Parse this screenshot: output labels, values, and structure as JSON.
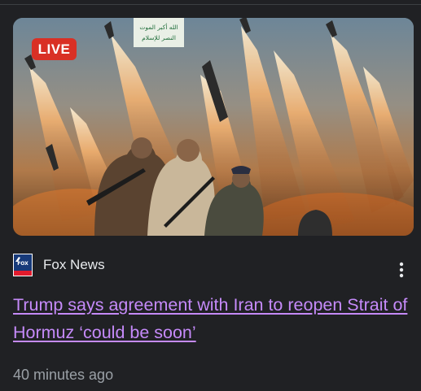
{
  "article": {
    "live_label": "LIVE",
    "source": "Fox News",
    "source_logo_text": "FOX NEWS",
    "headline": "Trump says agreement with Iran to reopen Strait of Hormuz ‘could be soon’",
    "timestamp": "40 minutes ago",
    "thumbnail_banner_lines": [
      "الله أكبر الموت",
      "النصر للإسلام"
    ],
    "more_icon": "more-vert-icon"
  },
  "colors": {
    "background": "#202124",
    "headline": "#c58af9",
    "live_badge": "#d93025",
    "timestamp": "#9aa0a6",
    "source_text": "#e8eaed"
  }
}
